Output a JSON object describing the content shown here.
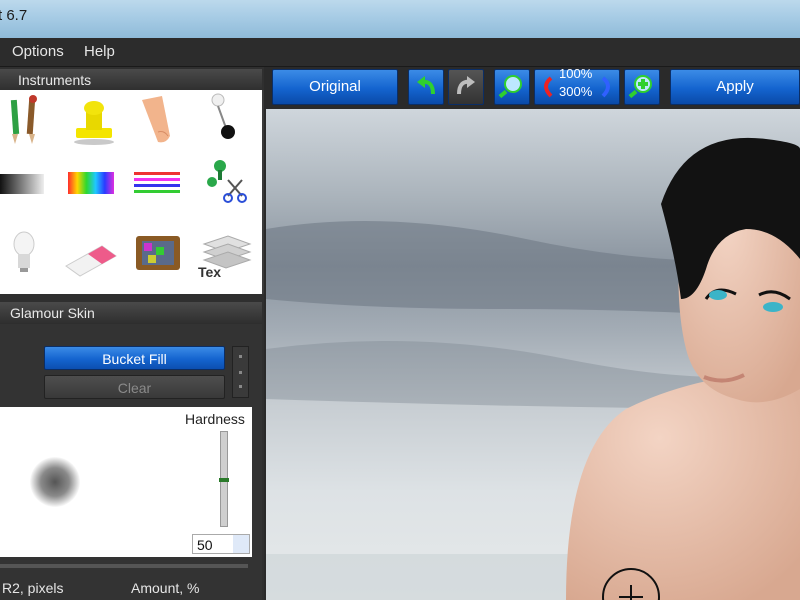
{
  "window": {
    "title": "t 6.7"
  },
  "menu": {
    "items": [
      "Options",
      "Help"
    ]
  },
  "instruments": {
    "header": "Instruments",
    "tools": [
      "pencils-icon",
      "stamp-icon",
      "finger-icon",
      "pin-icon",
      "gradient-icon",
      "rainbow-icon",
      "stripes-icon",
      "scissors-icon",
      "bulb-icon",
      "eraser-icon",
      "tv-icon",
      "text-layers-icon"
    ],
    "text_tool_label": "Tex"
  },
  "glamour": {
    "header": "Glamour Skin",
    "bucket_fill": "Bucket Fill",
    "clear": "Clear",
    "hardness_label": "Hardness",
    "hardness_value": "50",
    "hardness_level": 0.5,
    "r2_label": "R2, pixels",
    "amount_label": "Amount, %"
  },
  "toolbar": {
    "original": "Original",
    "zoom_top": "100%",
    "zoom_bottom": "300%",
    "apply": "Apply"
  },
  "colors": {
    "button_blue": "#1464cf",
    "panel_bg": "#2f2f2f",
    "title_bar": "#a9cde6"
  }
}
